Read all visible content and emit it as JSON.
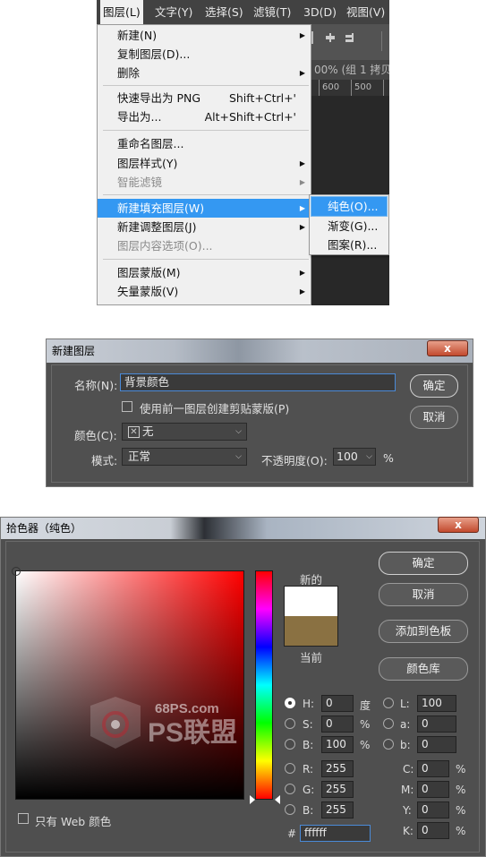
{
  "menubar": [
    "图层(L)",
    "文字(Y)",
    "选择(S)",
    "滤镜(T)",
    "3D(D)",
    "视图(V)"
  ],
  "ps_tab": "00% (组 1 拷贝",
  "ps_ruler": [
    "600",
    "500"
  ],
  "menu": [
    {
      "label": "新建(N)",
      "arrow": true
    },
    {
      "label": "复制图层(D)..."
    },
    {
      "label": "删除",
      "arrow": true
    },
    {
      "label": "快速导出为 PNG",
      "shortcut": "Shift+Ctrl+'"
    },
    {
      "label": "导出为...",
      "shortcut": "Alt+Shift+Ctrl+'"
    },
    {
      "label": "重命名图层..."
    },
    {
      "label": "图层样式(Y)",
      "arrow": true
    },
    {
      "label": "智能滤镜",
      "arrow": true,
      "disabled": true
    },
    {
      "label": "新建填充图层(W)",
      "arrow": true,
      "highlight": true
    },
    {
      "label": "新建调整图层(J)",
      "arrow": true
    },
    {
      "label": "图层内容选项(O)...",
      "disabled": true
    },
    {
      "label": "图层蒙版(M)",
      "arrow": true
    },
    {
      "label": "矢量蒙版(V)",
      "arrow": true
    }
  ],
  "submenu": [
    "纯色(O)...",
    "渐变(G)...",
    "图案(R)..."
  ],
  "new_layer": {
    "title": "新建图层",
    "name_label": "名称(N):",
    "name_value": "背景颜色",
    "clip_label": "使用前一图层创建剪贴蒙版(P)",
    "color_label": "颜色(C):",
    "color_value": "无",
    "mode_label": "模式:",
    "mode_value": "正常",
    "opacity_label": "不透明度(O):",
    "opacity_value": "100",
    "opacity_unit": "%",
    "ok": "确定",
    "cancel": "取消",
    "close": "x"
  },
  "picker": {
    "title": "拾色器（纯色）",
    "close": "x",
    "new_label": "新的",
    "current_label": "当前",
    "new_color": "#ffffff",
    "current_color": "#8a7142",
    "ok": "确定",
    "cancel": "取消",
    "add_swatch": "添加到色板",
    "library": "颜色库",
    "web_only": "只有 Web 颜色",
    "H": {
      "label": "H:",
      "value": "0",
      "unit": "度"
    },
    "S": {
      "label": "S:",
      "value": "0",
      "unit": "%"
    },
    "Bv": {
      "label": "B:",
      "value": "100",
      "unit": "%"
    },
    "R": {
      "label": "R:",
      "value": "255"
    },
    "G": {
      "label": "G:",
      "value": "255"
    },
    "B": {
      "label": "B:",
      "value": "255"
    },
    "L": {
      "label": "L:",
      "value": "100"
    },
    "a": {
      "label": "a:",
      "value": "0"
    },
    "b": {
      "label": "b:",
      "value": "0"
    },
    "C": {
      "label": "C:",
      "value": "0",
      "unit": "%"
    },
    "M": {
      "label": "M:",
      "value": "0",
      "unit": "%"
    },
    "Y": {
      "label": "Y:",
      "value": "0",
      "unit": "%"
    },
    "K": {
      "label": "K:",
      "value": "0",
      "unit": "%"
    },
    "hex_label": "#",
    "hex": "ffffff",
    "watermark_site": "68PS.com",
    "watermark_brand": "PS联盟"
  }
}
